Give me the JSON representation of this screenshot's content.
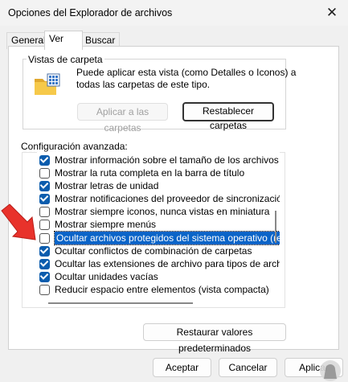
{
  "window": {
    "title": "Opciones del Explorador de archivos",
    "close_icon": "✕"
  },
  "tabs": [
    {
      "label": "General"
    },
    {
      "label": "Ver"
    },
    {
      "label": "Buscar"
    }
  ],
  "folder_views": {
    "legend": "Vistas de carpeta",
    "description_line1": "Puede aplicar esta vista (como Detalles o Iconos) a",
    "description_line2": "todas las carpetas de este tipo.",
    "apply_button": "Aplicar a las carpetas",
    "reset_button": "Restablecer carpetas"
  },
  "advanced": {
    "legend": "Configuración avanzada:",
    "items": [
      {
        "label": "Mostrar información sobre el tamaño de los archivos en re",
        "checked": true
      },
      {
        "label": "Mostrar la ruta completa en la barra de título",
        "checked": false
      },
      {
        "label": "Mostrar letras de unidad",
        "checked": true
      },
      {
        "label": "Mostrar notificaciones del proveedor de sincronización",
        "checked": true
      },
      {
        "label": "Mostrar siempre iconos, nunca vistas en miniatura",
        "checked": false
      },
      {
        "label": "Mostrar siempre menús",
        "checked": false
      },
      {
        "label": "Ocultar archivos protegidos del sistema operativo (recome",
        "checked": false
      },
      {
        "label": "Ocultar conflictos de combinación de carpetas",
        "checked": true
      },
      {
        "label": "Ocultar las extensiones de archivo para tipos de archivo c",
        "checked": true
      },
      {
        "label": "Ocultar unidades vacías",
        "checked": true
      },
      {
        "label": "Reducir espacio entre elementos (vista compacta)",
        "checked": false
      }
    ],
    "restore_button": "Restaurar valores predeterminados"
  },
  "footer": {
    "ok": "Aceptar",
    "cancel": "Cancelar",
    "apply": "Aplicar"
  },
  "colors": {
    "accent": "#0b5cad",
    "arrow": "#e8322b"
  }
}
